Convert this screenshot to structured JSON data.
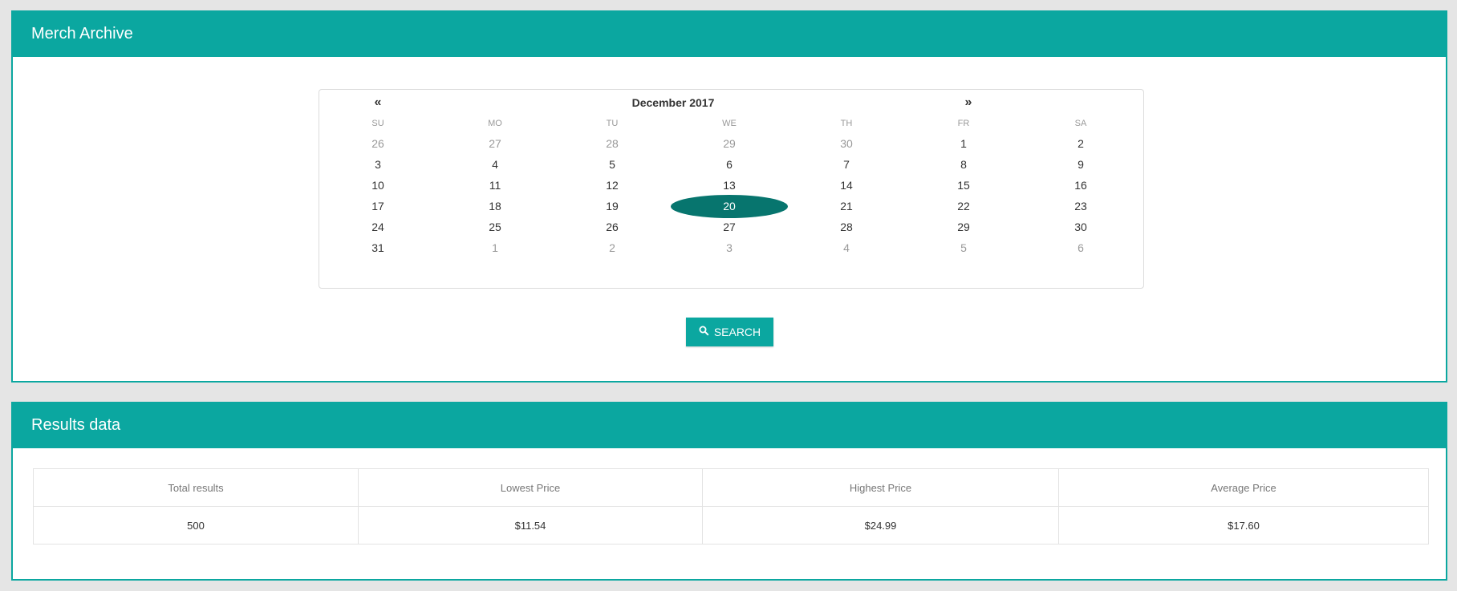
{
  "merch_panel": {
    "title": "Merch Archive"
  },
  "calendar": {
    "prev": "«",
    "next": "»",
    "month_label": "December 2017",
    "weekdays": [
      "SU",
      "MO",
      "TU",
      "WE",
      "TH",
      "FR",
      "SA"
    ],
    "weeks": [
      [
        {
          "d": "26",
          "m": true
        },
        {
          "d": "27",
          "m": true
        },
        {
          "d": "28",
          "m": true
        },
        {
          "d": "29",
          "m": true
        },
        {
          "d": "30",
          "m": true
        },
        {
          "d": "1"
        },
        {
          "d": "2"
        }
      ],
      [
        {
          "d": "3"
        },
        {
          "d": "4"
        },
        {
          "d": "5"
        },
        {
          "d": "6"
        },
        {
          "d": "7"
        },
        {
          "d": "8"
        },
        {
          "d": "9"
        }
      ],
      [
        {
          "d": "10"
        },
        {
          "d": "11"
        },
        {
          "d": "12"
        },
        {
          "d": "13"
        },
        {
          "d": "14"
        },
        {
          "d": "15"
        },
        {
          "d": "16"
        }
      ],
      [
        {
          "d": "17"
        },
        {
          "d": "18"
        },
        {
          "d": "19"
        },
        {
          "d": "20",
          "sel": true
        },
        {
          "d": "21"
        },
        {
          "d": "22"
        },
        {
          "d": "23"
        }
      ],
      [
        {
          "d": "24"
        },
        {
          "d": "25"
        },
        {
          "d": "26"
        },
        {
          "d": "27"
        },
        {
          "d": "28"
        },
        {
          "d": "29"
        },
        {
          "d": "30"
        }
      ],
      [
        {
          "d": "31"
        },
        {
          "d": "1",
          "m": true
        },
        {
          "d": "2",
          "m": true
        },
        {
          "d": "3",
          "m": true
        },
        {
          "d": "4",
          "m": true
        },
        {
          "d": "5",
          "m": true
        },
        {
          "d": "6",
          "m": true
        }
      ]
    ],
    "selected_color": "#07756e"
  },
  "search": {
    "label": "SEARCH",
    "icon": "search-icon"
  },
  "results_panel": {
    "title": "Results data",
    "headers": [
      "Total results",
      "Lowest Price",
      "Highest Price",
      "Average Price"
    ],
    "values": [
      "500",
      "$11.54",
      "$24.99",
      "$17.60"
    ]
  },
  "theme": {
    "accent": "#0ba7a0",
    "background": "#e5e5e5"
  }
}
